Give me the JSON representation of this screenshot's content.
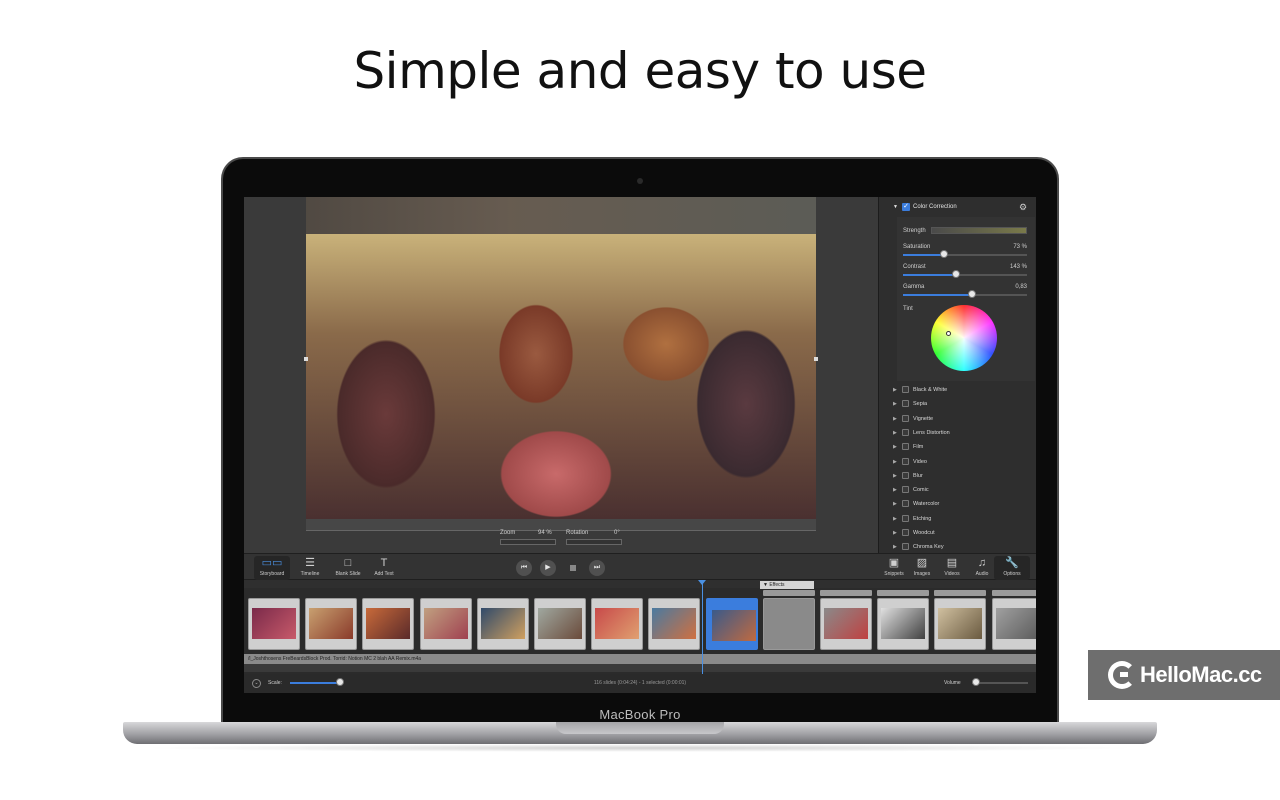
{
  "headline": "Simple and easy to use",
  "device_label": "MacBook Pro",
  "preview": {
    "zoom_label": "Zoom",
    "zoom_value": "94 %",
    "rotation_label": "Rotation",
    "rotation_value": "0°"
  },
  "inspector": {
    "section_title": "Color Correction",
    "section_checked": true,
    "strength_label": "Strength",
    "params": [
      {
        "label": "Saturation",
        "value": "73 %",
        "level": 0.33
      },
      {
        "label": "Contrast",
        "value": "143 %",
        "level": 0.43
      },
      {
        "label": "Gamma",
        "value": "0,83",
        "level": 0.56
      }
    ],
    "tint_label": "Tint",
    "effects": [
      "Black & White",
      "Sepia",
      "Vignette",
      "Lens Distortion",
      "Film",
      "Video",
      "Blur",
      "Comic",
      "Watercolor",
      "Etching",
      "Woodcut",
      "Chroma Key"
    ]
  },
  "toolbar": {
    "left": [
      {
        "label": "Storyboard",
        "icon": "storyboard-icon"
      },
      {
        "label": "Timeline",
        "icon": "timeline-icon"
      },
      {
        "label": "Blank Slide",
        "icon": "blank-slide-icon"
      },
      {
        "label": "Add Text",
        "icon": "text-icon"
      }
    ],
    "right": [
      {
        "label": "Snippets",
        "icon": "monitor-icon"
      },
      {
        "label": "Images",
        "icon": "image-icon"
      },
      {
        "label": "Videos",
        "icon": "film-icon"
      },
      {
        "label": "Audio",
        "icon": "music-note-icon"
      },
      {
        "label": "Options",
        "icon": "wrench-icon"
      }
    ]
  },
  "timeline": {
    "effects_tag": "▼ Effects",
    "audio_track": "/l_Joshthosens FreBeardsBlock Prod. Torrid: Notion MC 2 blah AA Remix.m4a",
    "status_text": "116 slides (0:04:24) - 1 selected (0:00:01)",
    "scale_label": "Scale:",
    "volume_label": "Volume"
  },
  "badge": "HelloMac.cc"
}
